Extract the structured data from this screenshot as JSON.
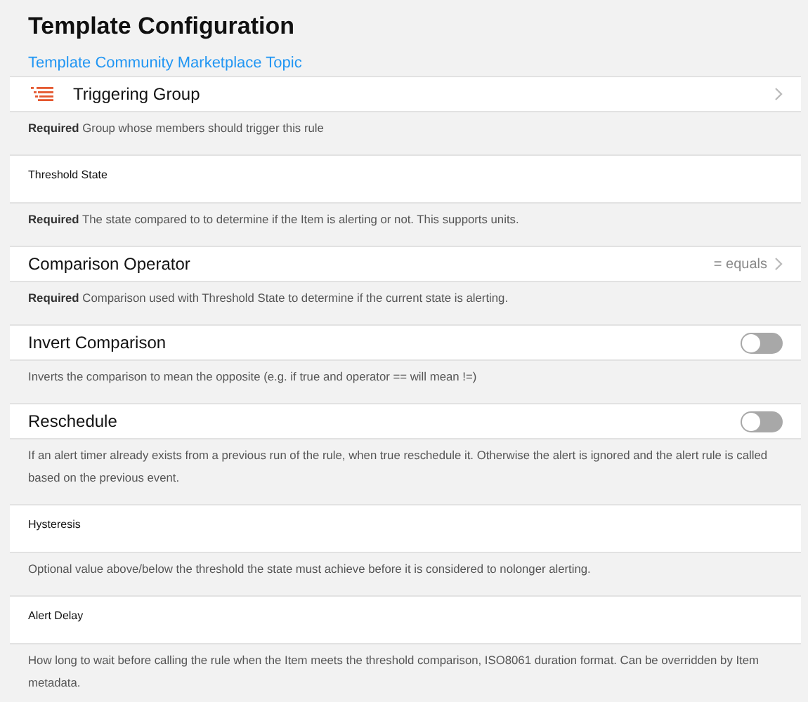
{
  "title": "Template Configuration",
  "link": "Template Community Marketplace Topic",
  "params": [
    {
      "kind": "group",
      "label": "Triggering Group",
      "description": "**Required** Group whose members should trigger this rule"
    },
    {
      "kind": "input",
      "label": "Threshold State",
      "description": "**Required** The state compared to to determine if the Item is alerting or not. This supports units."
    },
    {
      "kind": "select",
      "label": "Comparison Operator",
      "value": "= equals",
      "description": "**Required** Comparison used with Threshold State to determine if the current state is alerting."
    },
    {
      "kind": "toggle",
      "label": "Invert Comparison",
      "on": false,
      "description": "Inverts the comparison to mean the opposite (e.g. if true and operator == will mean !=)"
    },
    {
      "kind": "toggle",
      "label": "Reschedule",
      "on": false,
      "description": "If an alert timer already exists from a previous run of the rule, when true reschedule it. Otherwise the alert is ignored and the alert rule is called based on the previous event."
    },
    {
      "kind": "input",
      "label": "Hysteresis",
      "description": "Optional value above/below the threshold the state must achieve before it is considered to nolonger alerting."
    },
    {
      "kind": "input",
      "label": "Alert Delay",
      "description": "How long to wait before calling the rule when the Item meets the threshold comparison, ISO8061 duration format. Can be overridden by Item metadata."
    }
  ]
}
